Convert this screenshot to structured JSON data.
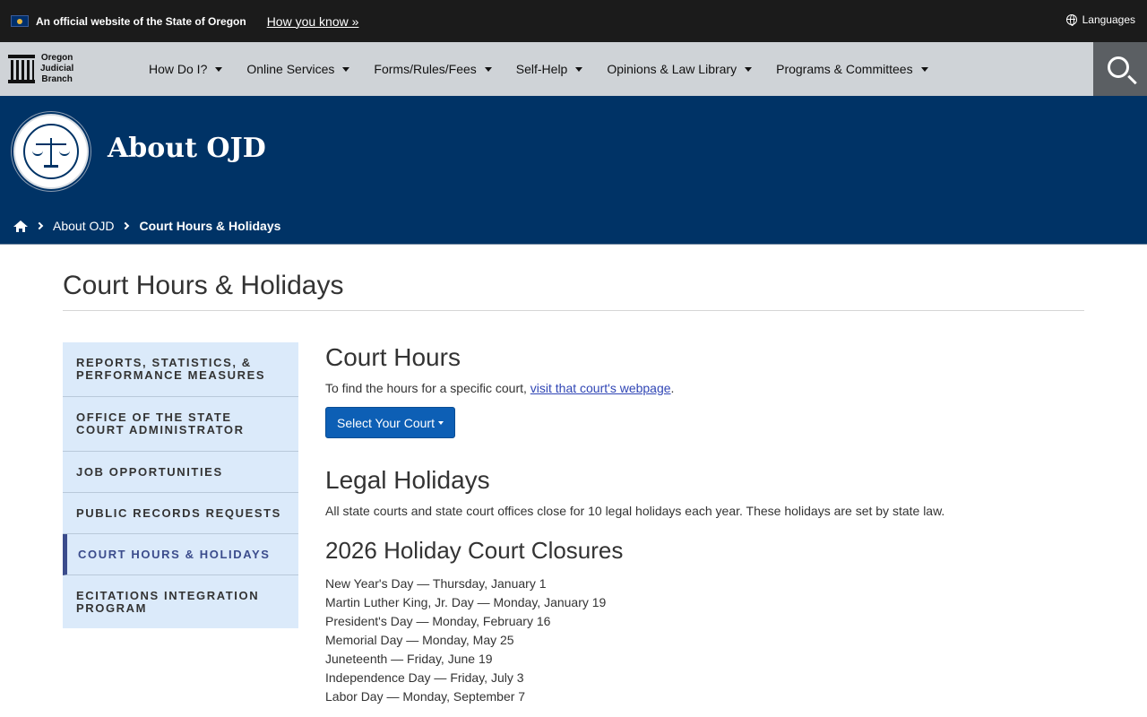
{
  "official_bar": {
    "text": "An official website of the State of Oregon",
    "how_you_know": "How you know »",
    "languages": "Languages"
  },
  "logo": {
    "line1": "Oregon",
    "line2": "Judicial",
    "line3": "Branch"
  },
  "nav": {
    "items": [
      {
        "label": "How Do I?"
      },
      {
        "label": "Online Services"
      },
      {
        "label": "Forms/Rules/Fees"
      },
      {
        "label": "Self-Help"
      },
      {
        "label": "Opinions & Law Library"
      },
      {
        "label": "Programs & Committees"
      }
    ]
  },
  "hero": {
    "title": "About OJD"
  },
  "breadcrumb": {
    "parent": "About OJD",
    "current": "Court Hours & Holidays"
  },
  "page": {
    "title": "Court Hours & Holidays"
  },
  "sidebar": {
    "items": [
      {
        "label": "Reports, Statistics, & Performance Measures"
      },
      {
        "label": "Office of the State Court Administrator"
      },
      {
        "label": "Job Opportunities"
      },
      {
        "label": "Public Records Requests"
      },
      {
        "label": "Court Hours & Holidays"
      },
      {
        "label": "eCitations Integration Program"
      }
    ]
  },
  "content": {
    "court_hours_heading": "Court Hours",
    "court_hours_text": "To find the hours for a specific court, ",
    "court_hours_link": "visit that court's webpage",
    "court_hours_period": ".",
    "select_court_button": "Select Your Court",
    "legal_holidays_heading": "Legal Holidays",
    "legal_holidays_text": "All state courts and state court offices close for 10 legal holidays each year. These holidays are set by state law.",
    "closures_heading": "2026 Holiday Court Closures",
    "holidays": [
      "New Year's Day — Thursday, January 1",
      "Martin Luther King, Jr. Day — Monday, January 19",
      "President's Day — Monday, February 16",
      "Memorial Day — Monday, May 25",
      "Juneteenth — Friday, June 19",
      "Independence Day — Friday, July 3",
      "Labor Day — Monday, September 7"
    ]
  },
  "colors": {
    "official_bar_bg": "#1b1b1b",
    "nav_bg": "#cfd3d7",
    "hero_bg": "#003366",
    "sidebar_bg": "#dbeafa",
    "button_bg": "#0d5fb5",
    "active_accent": "#3b4c8c",
    "link": "#3046b5"
  },
  "icons": {
    "flag": "oregon-flag-icon",
    "globe": "globe-icon",
    "search": "search-icon",
    "home": "home-icon",
    "chevron": "chevron-right-icon",
    "caret": "caret-down-icon",
    "seal": "judicial-department-seal"
  }
}
